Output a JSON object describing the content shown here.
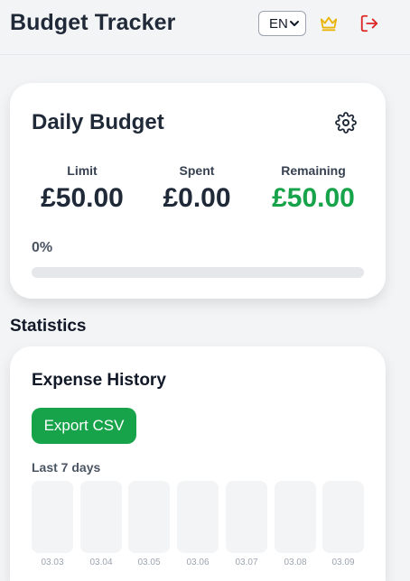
{
  "header": {
    "title": "Budget Tracker",
    "language": "EN",
    "icons": {
      "premium": "crown-icon",
      "logout": "logout-icon",
      "language_chevron": "chevron-down-icon"
    }
  },
  "budget": {
    "title": "Daily Budget",
    "settings_icon": "gear-icon",
    "limit_label": "Limit",
    "limit_value": "£50.00",
    "spent_label": "Spent",
    "spent_value": "£0.00",
    "remaining_label": "Remaining",
    "remaining_value": "£50.00",
    "progress_label": "0%",
    "progress_fraction": 0
  },
  "statistics": {
    "title": "Statistics",
    "history_title": "Expense History",
    "export_label": "Export CSV",
    "range_label": "Last 7 days",
    "days": [
      "03.03",
      "03.04",
      "03.05",
      "03.06",
      "03.07",
      "03.08",
      "03.09"
    ]
  },
  "colors": {
    "accent_green": "#16a34a",
    "crown_gold": "#eab308",
    "logout_red": "#dc2626",
    "text_dark": "#1f2937"
  }
}
